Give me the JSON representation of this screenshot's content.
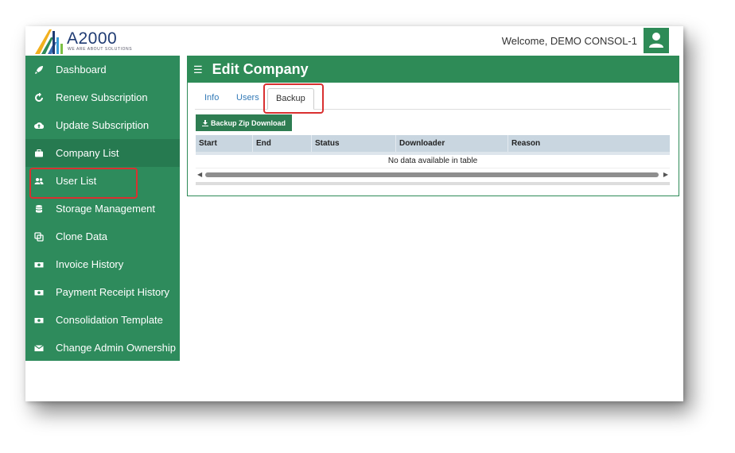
{
  "header": {
    "logo_text": "A2000",
    "logo_tagline": "WE ARE ABOUT SOLUTIONS",
    "welcome_text": "Welcome, DEMO CONSOL-1"
  },
  "sidebar": {
    "active": "Company List",
    "items": [
      {
        "label": "Dashboard",
        "icon": "rocket-icon"
      },
      {
        "label": "Renew Subscription",
        "icon": "refresh-icon"
      },
      {
        "label": "Update Subscription",
        "icon": "cloud-upload-icon"
      },
      {
        "label": "Company List",
        "icon": "briefcase-icon"
      },
      {
        "label": "User List",
        "icon": "users-icon"
      },
      {
        "label": "Storage Management",
        "icon": "database-icon"
      },
      {
        "label": "Clone Data",
        "icon": "clone-icon"
      },
      {
        "label": "Invoice History",
        "icon": "money-icon"
      },
      {
        "label": "Payment Receipt History",
        "icon": "money-icon"
      },
      {
        "label": "Consolidation Template",
        "icon": "money-icon"
      },
      {
        "label": "Change Admin Ownership",
        "icon": "envelope-icon"
      }
    ]
  },
  "main": {
    "title": "Edit Company",
    "tabs": [
      {
        "label": "Info"
      },
      {
        "label": "Users"
      },
      {
        "label": "Backup"
      }
    ],
    "active_tab": "Backup",
    "download_button": "Backup Zip Download",
    "table": {
      "columns": [
        "Start",
        "End",
        "Status",
        "Downloader",
        "Reason"
      ],
      "empty_message": "No data available in table"
    }
  },
  "colors": {
    "brand_green": "#2e8b57",
    "highlight_red": "#d93030",
    "link_blue": "#337ab7"
  }
}
